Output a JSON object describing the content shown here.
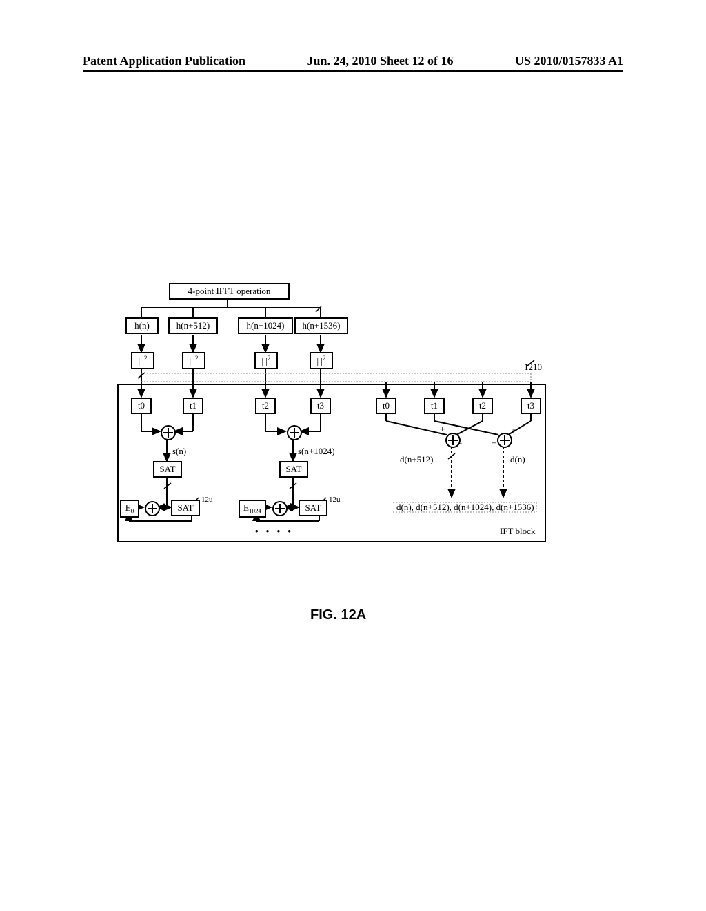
{
  "header": {
    "left": "Patent Application Publication",
    "center": "Jun. 24, 2010  Sheet 12 of 16",
    "right": "US 2010/0157833 A1"
  },
  "figure_label": "FIG. 12A",
  "blocks": {
    "ifft": "4-point IFFT operation",
    "h0": "h(n)",
    "h1": "h(n+512)",
    "h2": "h(n+1024)",
    "h3": "h(n+1536)",
    "magsq0": "| |²",
    "magsq1": "| |²",
    "magsq2": "| |²",
    "magsq3": "| |²",
    "t0a": "t0",
    "t1a": "t1",
    "t2a": "t2",
    "t3a": "t3",
    "t0b": "t0",
    "t1b": "t1",
    "t2b": "t2",
    "t3b": "t3",
    "sat1": "SAT",
    "sat2": "SAT",
    "sat3": "SAT",
    "sat4": "SAT",
    "e0": "E₀",
    "e1024": "E₁₀₂₄",
    "ift_label": "IFT block",
    "ref_1210": "1210",
    "ref_12u_a": "12u",
    "ref_12u_b": "12u"
  },
  "labels": {
    "sn": "s(n)",
    "sn1024": "s(n+1024)",
    "dn": "d(n)",
    "dn512": "d(n+512)",
    "d_list": "d(n), d(n+512), d(n+1024), d(n+1536)",
    "plus": "+",
    "minus": "-"
  },
  "ellipsis": "•    •    •    •"
}
